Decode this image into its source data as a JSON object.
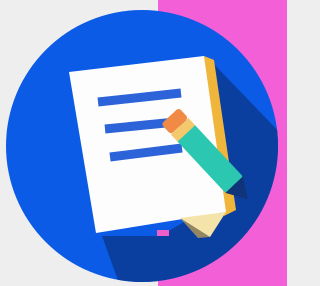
{
  "colors": {
    "background_left": "#eeeeee",
    "background_right": "#f25fd6",
    "circle": "#0c5be6",
    "shadow": "#0a3f9f",
    "page": "#fdfdfd",
    "page_fold": "#f4e4a9",
    "page_edge": "#f0b63c",
    "text_lines": "#2d63d8",
    "pencil_body": "#2bc7b0",
    "pencil_band": "#f4c86d",
    "pencil_eraser": "#f08a45",
    "pencil_tip": "#0f347a",
    "pink_accent": "#f05fc9"
  },
  "icons": {
    "document": "document-icon",
    "pencil": "pencil-icon"
  }
}
